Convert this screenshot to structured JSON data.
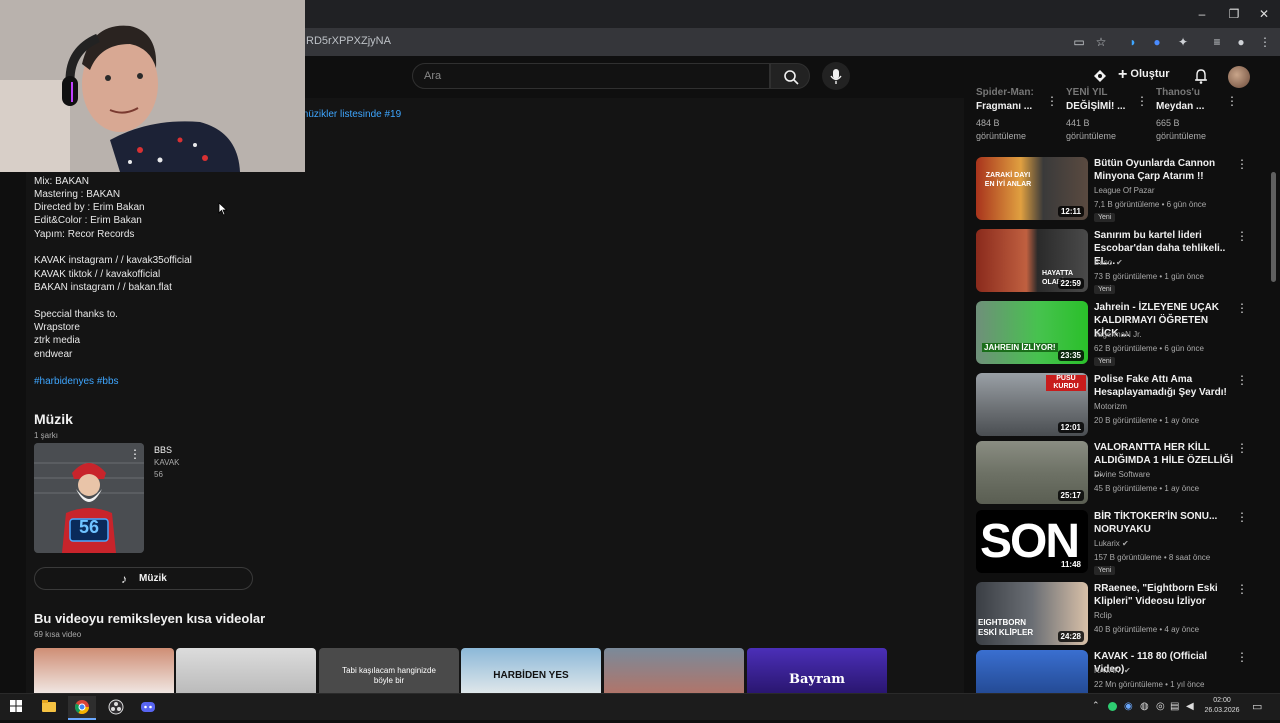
{
  "browser": {
    "url_fragment": "RD5rXPPXZjyNA"
  },
  "header": {
    "search_placeholder": "Ara",
    "create_label": "Oluştur"
  },
  "description": {
    "hashtag_top": "müzikler listesinde #19",
    "lines": [
      "Mix: BAKAN",
      "Mastering : BAKAN",
      "Directed by : Erim Bakan",
      "Edit&Color : Erim Bakan",
      "Yapım: Recor Records",
      "KAVAK instagram /   / kavak35official",
      "KAVAK tiktok /   / kavakofficial",
      "BAKAN instagram /   / bakan.flat",
      "Speccial thanks to.",
      "Wrapstore",
      "ztrk media",
      "endwear"
    ],
    "hashtags": "#harbidenyes #bbs"
  },
  "music": {
    "title": "Müzik",
    "count": "1 şarkı",
    "song_title": "BBS",
    "song_artist": "KAVAK",
    "song_album": "56",
    "card_number": "56",
    "button_label": "Müzik"
  },
  "remix": {
    "title": "Bu videoyu remiksleyen kısa videolar",
    "count": "69 kısa video",
    "shorts": [
      {
        "text": ""
      },
      {
        "text": ""
      },
      {
        "text": "Tabi kaşılacam hanginizde böyle bir"
      },
      {
        "text": "HARBİDEN YES"
      },
      {
        "text": ""
      },
      {
        "text": "Bayram"
      }
    ]
  },
  "top_cards": [
    {
      "title1": "Spider-Man:",
      "title2": "Fragmanı ...",
      "views1": "484 B",
      "views2": "görüntüleme"
    },
    {
      "title1": "YENİ YIL",
      "title2": "DEĞİŞİMİ! ...",
      "views1": "441 B",
      "views2": "görüntüleme"
    },
    {
      "title1": "Thanos'u",
      "title2": "Meydan ...",
      "views1": "665 B",
      "views2": "görüntüleme"
    }
  ],
  "sidebar": [
    {
      "title": "Bütün Oyunlarda Cannon Minyona Çarp Atarım !!",
      "channel": "League Of Pazar",
      "meta": "7,1 B görüntüleme • 6 gün önce",
      "badge": "Yeni",
      "duration": "12:11",
      "thumb_text": "ZARAKİ DAYI EN İYİ ANLAR",
      "verified": false
    },
    {
      "title": "Sanırım bu kartel lideri Escobar'dan daha tehlikeli.. EL...",
      "channel": "Baso",
      "meta": "73 B görüntüleme • 1 gün önce",
      "badge": "Yeni",
      "duration": "22:59",
      "thumb_text": "HAYATTA OLABİ...",
      "verified": true
    },
    {
      "title": "Jahrein - İZLEYENE UÇAK KALDIRMAYI ÖĞRETEN KİCK ...",
      "channel": "JagermaN Jr.",
      "meta": "62 B görüntüleme • 6 gün önce",
      "badge": "Yeni",
      "duration": "23:35",
      "thumb_text": "JAHREIN İZLİYOR!",
      "verified": false
    },
    {
      "title": "Polise Fake Attı Ama Hesaplayamadığı Şey Vardı!",
      "channel": "Motorizm",
      "meta": "20 B görüntüleme • 1 ay önce",
      "badge": "",
      "duration": "12:01",
      "thumb_text": "PUSU KURDU",
      "verified": false
    },
    {
      "title": "VALORANTTA HER KİLL ALDIĞIMDA 1 HİLE ÖZELLİĞİ ...",
      "channel": "Divine Software",
      "meta": "45 B görüntüleme • 1 ay önce",
      "badge": "",
      "duration": "25:17",
      "thumb_text": "",
      "verified": false
    },
    {
      "title": "BİR TİKTOKER'İN SONU... NORUYAKU",
      "channel": "Lukarix",
      "meta": "157 B görüntüleme • 8 saat önce",
      "badge": "Yeni",
      "duration": "11:48",
      "thumb_text": "SON",
      "verified": true
    },
    {
      "title": "RRaenee, \"Eightborn Eski Klipleri\" Videosu İzliyor",
      "channel": "Rclip",
      "meta": "40 B görüntüleme • 4 ay önce",
      "badge": "",
      "duration": "24:28",
      "thumb_text": "EIGHTBORN ESKİ KLİPLER",
      "verified": false
    },
    {
      "title": "KAVAK - 118 80 (Official Video)",
      "channel": "KAVAK",
      "meta": "22 Mn görüntüleme • 1 yıl önce",
      "badge": "",
      "duration": "",
      "thumb_text": "",
      "verified": true
    }
  ],
  "taskbar": {
    "time": "02:00",
    "date": "26.03.2026"
  },
  "colors": {
    "accent_link": "#3ea6ff",
    "background": "#0f0f0f"
  }
}
